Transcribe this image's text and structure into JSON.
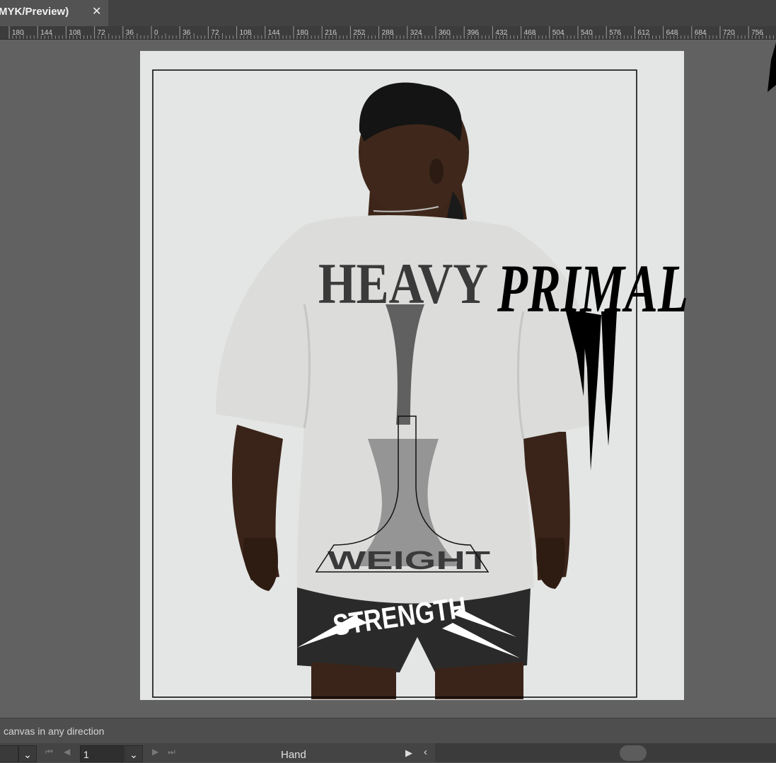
{
  "document_tab": {
    "title": "MYK/Preview)",
    "close_glyph": "✕"
  },
  "ruler": {
    "labels": [
      "180",
      "144",
      "108",
      "72",
      "36",
      "0",
      "36",
      "72",
      "108",
      "144",
      "180",
      "216",
      "252",
      "288",
      "324",
      "360",
      "396",
      "432",
      "468",
      "504",
      "540",
      "576",
      "612",
      "648",
      "684",
      "720",
      "756"
    ]
  },
  "artwork": {
    "texts": [
      "HEAVY",
      "PRIMAL",
      "WEIGHT",
      "STRENGTH"
    ]
  },
  "status_bar": {
    "hint": "canvas in any direction"
  },
  "bottom_bar": {
    "page_value": "1",
    "dropdown_glyph": "⌄",
    "tool_name": "Hand",
    "first_glyph": "⏮",
    "prev_glyph": "◀",
    "next_glyph": "▶",
    "last_glyph": "⏭",
    "play_glyph": "▶",
    "left_glyph": "‹"
  },
  "colors": {
    "artboard": "#e4e6e5",
    "pasteboard": "#616161",
    "shirt": "#dcdddb"
  }
}
